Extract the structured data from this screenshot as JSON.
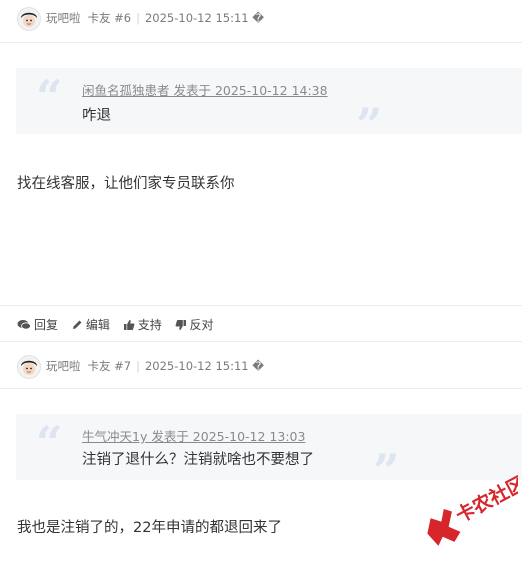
{
  "posts": [
    {
      "username": "玩吧啦",
      "floor": "卡友 #6",
      "time": "2025-10-12 15:11 �",
      "quote_author": "闲鱼名孤独患者 发表于 2025-10-12 14:38",
      "quote_text": "咋退",
      "content": "找在线客服，让他们家专员联系你",
      "actions": {
        "reply": "回复",
        "edit": "编辑",
        "support": "支持",
        "oppose": "反对"
      }
    },
    {
      "username": "玩吧啦",
      "floor": "卡友 #7",
      "time": "2025-10-12 15:11 �",
      "quote_author": "牛气冲天1y 发表于 2025-10-12 13:03",
      "quote_text": "注销了退什么？注销就啥也不要想了",
      "content": "我也是注销了的，22年申请的都退回来了"
    }
  ],
  "watermark": {
    "text": "卡农社区"
  },
  "colors": {
    "quote_bg": "#f6f7f9",
    "quote_mark": "#dce5f0",
    "watermark": "#d7262b"
  }
}
